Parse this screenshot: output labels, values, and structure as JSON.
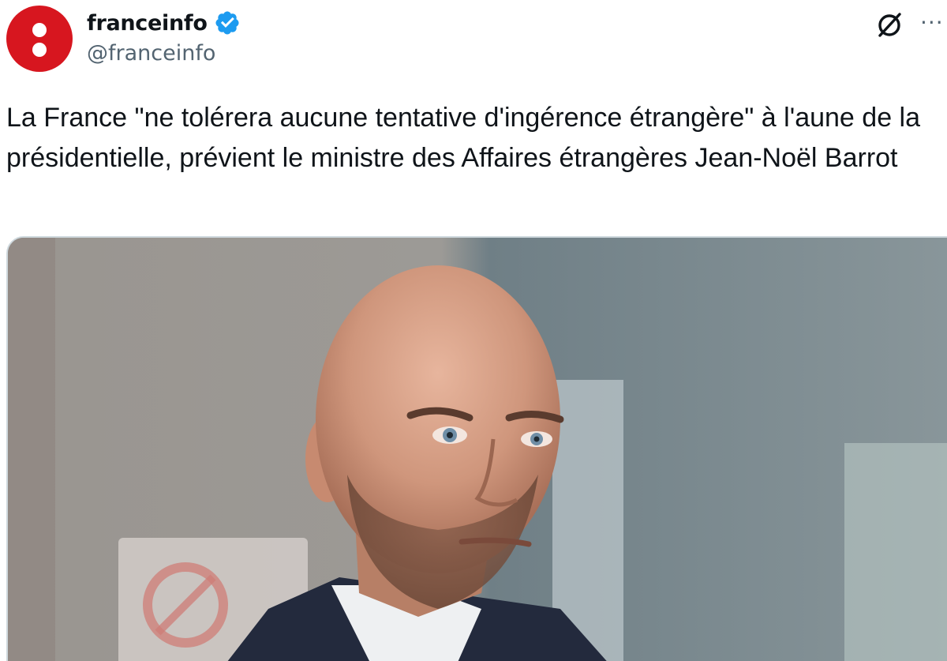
{
  "account": {
    "display_name": "franceinfo",
    "handle": "@franceinfo",
    "verified": true,
    "avatar_color": "#d7161f"
  },
  "tweet": {
    "text": "La France \"ne tolérera aucune tentative d'ingérence étrangère\" à l'aune de la présidentielle, prévient le ministre des Affaires étrangères Jean-Noël Barrot"
  },
  "icons": {
    "verified": "verified-badge-icon",
    "grok": "grok-icon",
    "more": "more-options-icon"
  },
  "colors": {
    "verified_blue": "#1d9bf0",
    "handle_gray": "#536471",
    "text": "#0f1419",
    "border": "#cfd9de"
  }
}
